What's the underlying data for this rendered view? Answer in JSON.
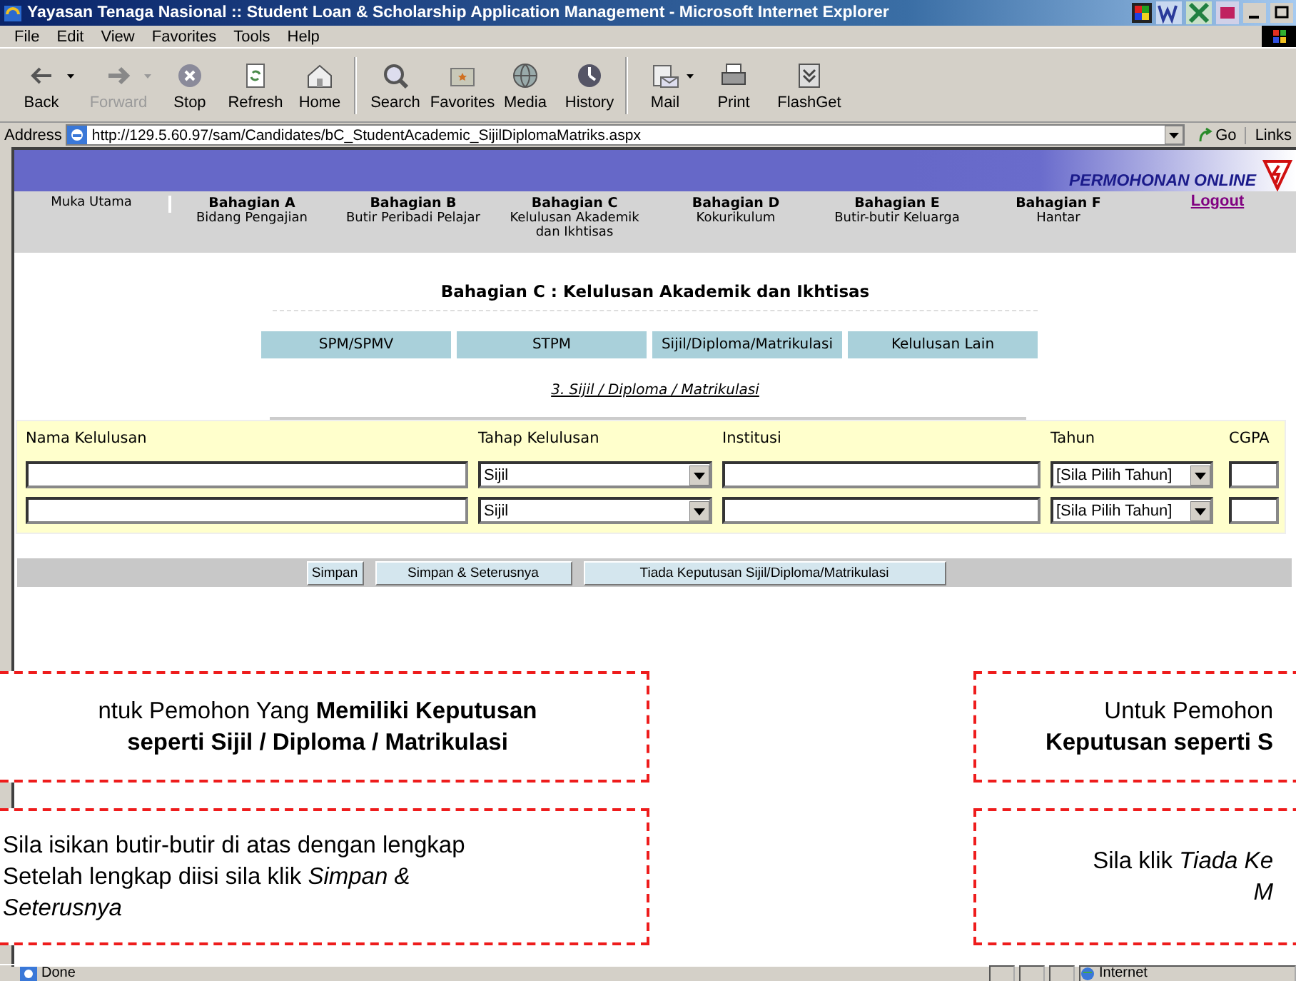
{
  "window": {
    "title": "Yayasan Tenaga Nasional :: Student Loan & Scholarship Application Management - Microsoft Internet Explorer"
  },
  "menu": [
    "File",
    "Edit",
    "View",
    "Favorites",
    "Tools",
    "Help"
  ],
  "toolbar": [
    {
      "label": "Back",
      "disabled": false,
      "dropdown": true
    },
    {
      "label": "Forward",
      "disabled": true,
      "dropdown": true
    },
    {
      "label": "Stop",
      "disabled": false,
      "dropdown": false
    },
    {
      "label": "Refresh",
      "disabled": false,
      "dropdown": false
    },
    {
      "label": "Home",
      "disabled": false,
      "dropdown": false
    },
    {
      "label": "Search",
      "disabled": false,
      "dropdown": false
    },
    {
      "label": "Favorites",
      "disabled": false,
      "dropdown": false
    },
    {
      "label": "Media",
      "disabled": false,
      "dropdown": false
    },
    {
      "label": "History",
      "disabled": false,
      "dropdown": false
    },
    {
      "label": "Mail",
      "disabled": false,
      "dropdown": true
    },
    {
      "label": "Print",
      "disabled": false,
      "dropdown": false
    },
    {
      "label": "FlashGet",
      "disabled": false,
      "dropdown": false
    }
  ],
  "address": {
    "label": "Address",
    "value": "http://129.5.60.97/sam/Candidates/bC_StudentAcademic_SijilDiplomaMatriks.aspx",
    "go": "Go",
    "links": "Links"
  },
  "banner": {
    "title": "PERMOHONAN ONLINE"
  },
  "nav": [
    {
      "title": "Muka Utama"
    },
    {
      "title": "Bahagian A",
      "subtitle": "Bidang Pengajian"
    },
    {
      "title": "Bahagian B",
      "subtitle": "Butir Peribadi Pelajar"
    },
    {
      "title": "Bahagian C",
      "subtitle": "Kelulusan Akademik dan Ikhtisas"
    },
    {
      "title": "Bahagian D",
      "subtitle": "Kokurikulum"
    },
    {
      "title": "Bahagian E",
      "subtitle": "Butir-butir Keluarga"
    },
    {
      "title": "Bahagian F",
      "subtitle": "Hantar"
    }
  ],
  "logout": "Logout",
  "heading": "Bahagian C : Kelulusan Akademik dan Ikhtisas",
  "tabs": [
    "SPM/SPMV",
    "STPM",
    "Sijil/Diploma/Matrikulasi",
    "Kelulusan Lain"
  ],
  "subtitle": "3. Sijil / Diploma / Matrikulasi",
  "form": {
    "columns": [
      "Nama Kelulusan",
      "Tahap Kelulusan",
      "Institusi",
      "Tahun",
      "CGPA"
    ],
    "rows": [
      {
        "tahap": "Sijil",
        "tahun": "[Sila Pilih Tahun]"
      },
      {
        "tahap": "Sijil",
        "tahun": "[Sila Pilih Tahun]"
      }
    ]
  },
  "buttons": [
    "Simpan",
    "Simpan & Seterusnya",
    "Tiada Keputusan Sijil/Diploma/Matrikulasi"
  ],
  "callouts": [
    {
      "lines": [
        "ntuk Pemohon Yang **Memiliki Keputusan**",
        "**seperti Sijil / Diploma / Matrikulasi**"
      ]
    },
    {
      "lines": [
        "Sila isikan butir-butir di atas dengan lengkap",
        "Setelah lengkap diisi sila klik *Simpan &*",
        "*Seterusnya*"
      ]
    },
    {
      "lines": [
        "Untuk Pemohon",
        "**Keputusan seperti S**"
      ]
    },
    {
      "lines": [
        "Sila klik *Tiada Ke*",
        "*M*"
      ]
    }
  ],
  "status": {
    "text": "Done",
    "zone": "Internet"
  }
}
